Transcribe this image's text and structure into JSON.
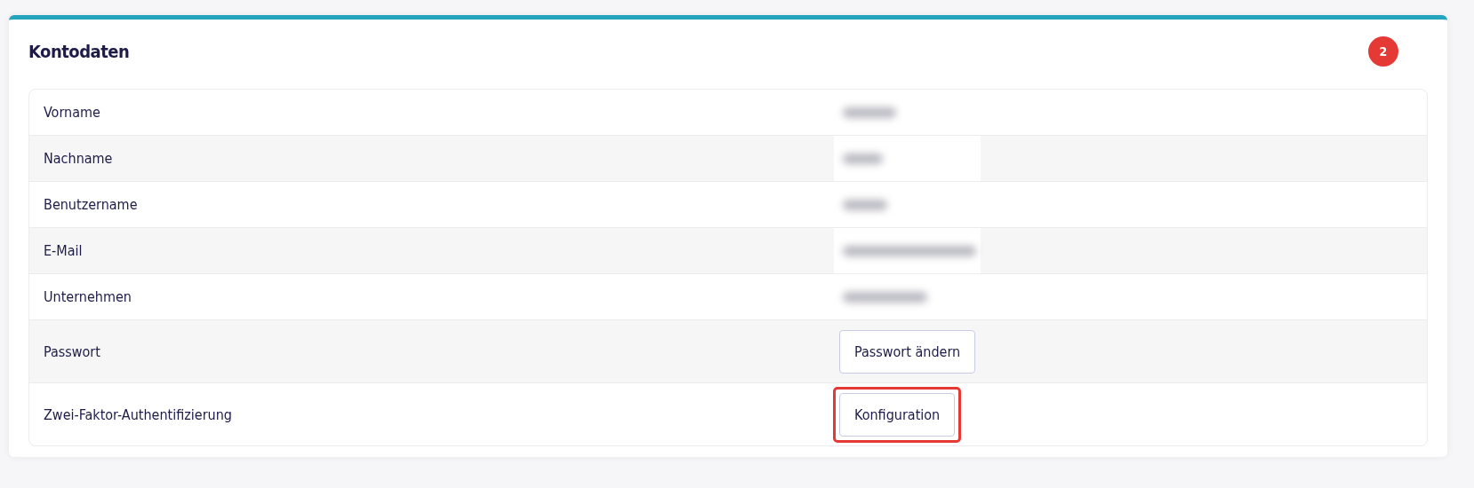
{
  "card": {
    "title": "Kontodaten",
    "annotation_badge": "2",
    "rows": [
      {
        "label": "Vorname",
        "kind": "redacted"
      },
      {
        "label": "Nachname",
        "kind": "redacted"
      },
      {
        "label": "Benutzername",
        "kind": "redacted"
      },
      {
        "label": "E-Mail",
        "kind": "redacted"
      },
      {
        "label": "Unternehmen",
        "kind": "redacted"
      },
      {
        "label": "Passwort",
        "kind": "button",
        "button": {
          "label": "Passwort ändern",
          "highlighted": false
        }
      },
      {
        "label": "Zwei-Faktor-Authentifizierung",
        "kind": "button",
        "button": {
          "label": "Konfiguration",
          "highlighted": true
        }
      }
    ]
  }
}
